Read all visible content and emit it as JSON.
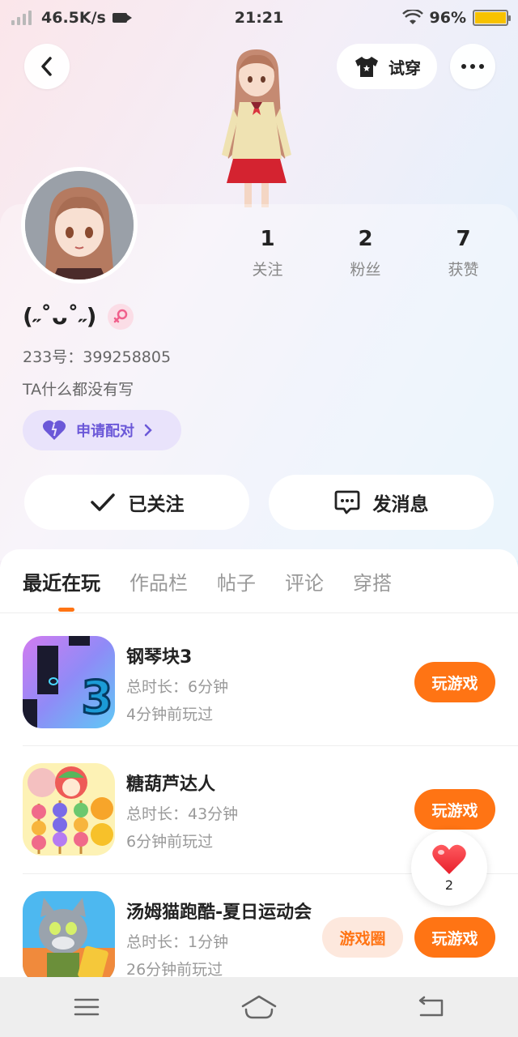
{
  "status_bar": {
    "speed": "46.5K/s",
    "time": "21:21",
    "battery": "96%"
  },
  "header": {
    "try_on_label": "试穿"
  },
  "profile": {
    "nickname": "(˶˚ᴗ˚˶)",
    "uid": "233号：399258805",
    "bio": "TA什么都没有写",
    "pair_label": "申请配对",
    "stats": [
      {
        "num": "1",
        "label": "关注"
      },
      {
        "num": "2",
        "label": "粉丝"
      },
      {
        "num": "7",
        "label": "获赞"
      }
    ],
    "follow_label": "已关注",
    "message_label": "发消息"
  },
  "tabs": [
    {
      "label": "最近在玩",
      "active": true
    },
    {
      "label": "作品栏"
    },
    {
      "label": "帖子"
    },
    {
      "label": "评论"
    },
    {
      "label": "穿搭"
    }
  ],
  "games": [
    {
      "title": "钢琴块3",
      "duration": "总时长：6分钟",
      "last_played": "4分钟前玩过",
      "play_label": "玩游戏"
    },
    {
      "title": "糖葫芦达人",
      "duration": "总时长：43分钟",
      "last_played": "6分钟前玩过",
      "play_label": "玩游戏"
    },
    {
      "title": "汤姆猫跑酷-夏日运动会",
      "duration": "总时长：1分钟",
      "last_played": "26分钟前玩过",
      "play_label": "玩游戏",
      "circle_label": "游戏圈"
    }
  ],
  "like_float": {
    "count": "2"
  },
  "colors": {
    "accent": "#ff7414",
    "pair_purple": "#6b58d8",
    "heart_red": "#f0303a"
  }
}
